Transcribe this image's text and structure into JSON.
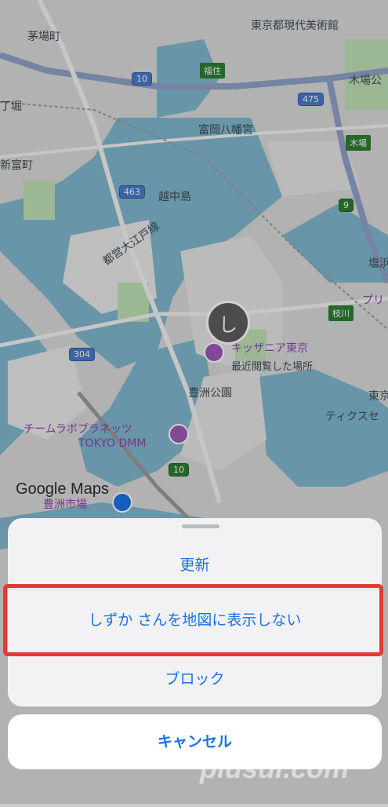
{
  "map": {
    "labels": [
      "茅場町",
      "東京都現代美術館",
      "木場公",
      "富岡八幡宮",
      "新富町",
      "越中島",
      "都営大江戸線",
      "塩浜",
      "枝川",
      "キッザニア東京",
      "最近閲覧した場所",
      "豊洲公園",
      "東京",
      "チームラボプラネッツ",
      "TOKYO DMM",
      "豊洲市場",
      "丁堀",
      "ティクスセ",
      "プリ"
    ],
    "routes": [
      "10",
      "475",
      "463",
      "304",
      "10",
      "9"
    ],
    "signs": [
      "福住",
      "木場",
      "枝川"
    ],
    "avatar_initial": "し",
    "logo": "Google Maps"
  },
  "sheet": {
    "actions": [
      "更新",
      "しずか さんを地図に表示しない",
      "ブロック"
    ],
    "cancel": "キャンセル"
  },
  "watermark": "plusul.com",
  "colors": {
    "accent": "#1a73e8",
    "highlight": "#e53935"
  }
}
